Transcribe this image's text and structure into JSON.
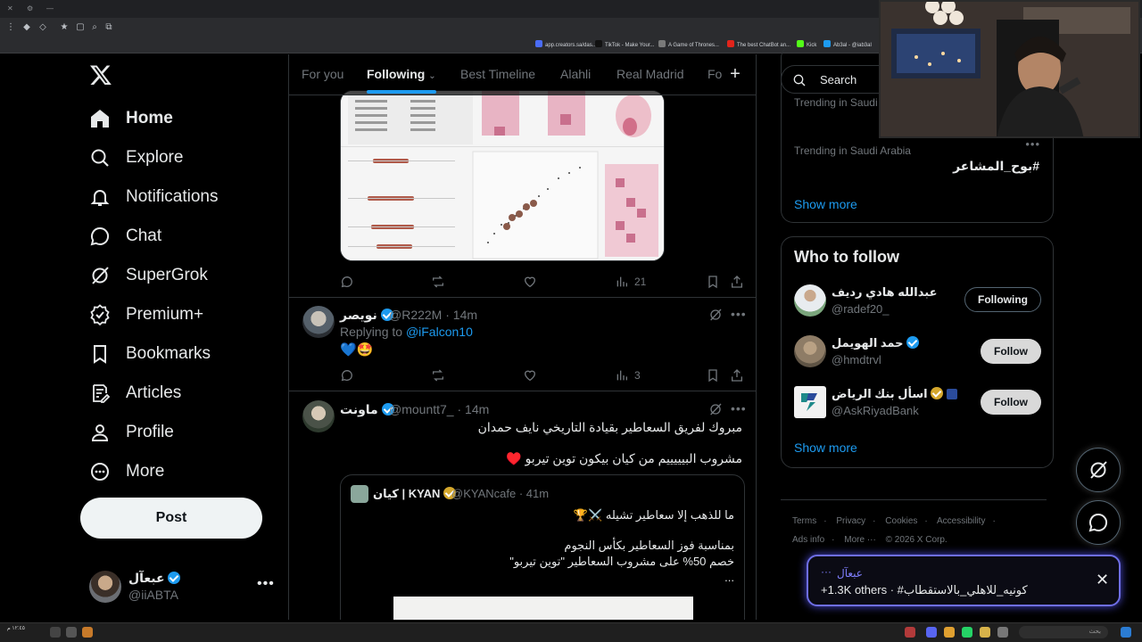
{
  "browser": {
    "bookmarks": [
      {
        "label": "app.creators.sa/das...",
        "color": "#4a6cf7"
      },
      {
        "label": "TikTok - Make Your...",
        "color": "#111111"
      },
      {
        "label": "A Game of Thrones...",
        "color": "#7a7a7a"
      },
      {
        "label": "The best ChatBot an...",
        "color": "#e2241b"
      },
      {
        "label": "Kick",
        "color": "#53fc18"
      },
      {
        "label": "Ab3al - @iab3al",
        "color": "#1d9bf0"
      }
    ]
  },
  "nav": {
    "items": [
      {
        "label": "Home",
        "icon": "home-icon"
      },
      {
        "label": "Explore",
        "icon": "search-icon"
      },
      {
        "label": "Notifications",
        "icon": "bell-icon"
      },
      {
        "label": "Chat",
        "icon": "chat-icon"
      },
      {
        "label": "SuperGrok",
        "icon": "grok-icon"
      },
      {
        "label": "Premium+",
        "icon": "premium-icon"
      },
      {
        "label": "Bookmarks",
        "icon": "bookmark-icon"
      },
      {
        "label": "Articles",
        "icon": "articles-icon"
      },
      {
        "label": "Profile",
        "icon": "profile-icon"
      },
      {
        "label": "More",
        "icon": "more-circle-icon"
      }
    ],
    "post_label": "Post",
    "account": {
      "name": "عبعآل",
      "handle": "@iiABTA"
    }
  },
  "timeline": {
    "tabs": [
      "For you",
      "Following",
      "Best Timeline",
      "Alahli",
      "Real Madrid",
      "Fo"
    ],
    "active_tab": "Following",
    "first_tweet_actions": {
      "views": "21"
    },
    "reply_tweet": {
      "name": "نويصر",
      "handle": "@R222M",
      "time": "14m",
      "replying_label": "Replying to",
      "replying_to": "@iFalcon10",
      "text": "💙🤩",
      "views": "3"
    },
    "quote_tweet": {
      "name": "ماونت",
      "handle": "@mountt7_",
      "time": "14m",
      "line1": "مبروك لفريق السعاطير بقيادة التاريخي نايف حمدان",
      "line2": "مشروب البيييييم من كيان بيكون توين تيربو ♥️",
      "quoted": {
        "name": "كيان | KYAN",
        "handle": "@KYANcafe",
        "time": "41m",
        "line1": "ما للذهب إلا سعاطير تشيله ⚔️🏆",
        "line2": "بمناسبة فوز السعاطير بكأس النجوم",
        "line3": "خصم 50% على مشروب السعاطير \"توين تيربو\"",
        "line4": "..."
      }
    }
  },
  "sidebar": {
    "search_placeholder": "Search",
    "trends": [
      {
        "context": "Trending in Saudi Arabia",
        "title": ""
      },
      {
        "context": "Trending in Saudi Arabia",
        "title": "#بوح_المشاعر"
      }
    ],
    "trends_show_more": "Show more",
    "who_to_follow": {
      "title": "Who to follow",
      "users": [
        {
          "name": "عبدالله هادي رديف",
          "handle": "@radef20_",
          "button": "Following"
        },
        {
          "name": "حمد الهويمل",
          "handle": "@hmdtrvl",
          "button": "Follow"
        },
        {
          "name": "اسأل بنك الرياض",
          "handle": "@AskRiyadBank",
          "button": "Follow"
        }
      ],
      "show_more": "Show more"
    },
    "footer_row1": [
      "Terms",
      "Privacy",
      "Cookies",
      "Accessibility"
    ],
    "footer_row2": [
      "Ads info",
      "More ···",
      "© 2026 X Corp."
    ]
  },
  "notification": {
    "name": "عبعآل",
    "dots": "···",
    "text": "+1.3K others · #كونيه_للاهلي_بالاستقطاب"
  },
  "taskbar": {
    "search_text": "بحث",
    "clock": "١٢:٤٥ م"
  },
  "colors": {
    "accent": "#1d9bf0",
    "background": "#000000",
    "border": "#2f3336",
    "muted": "#71767b"
  }
}
